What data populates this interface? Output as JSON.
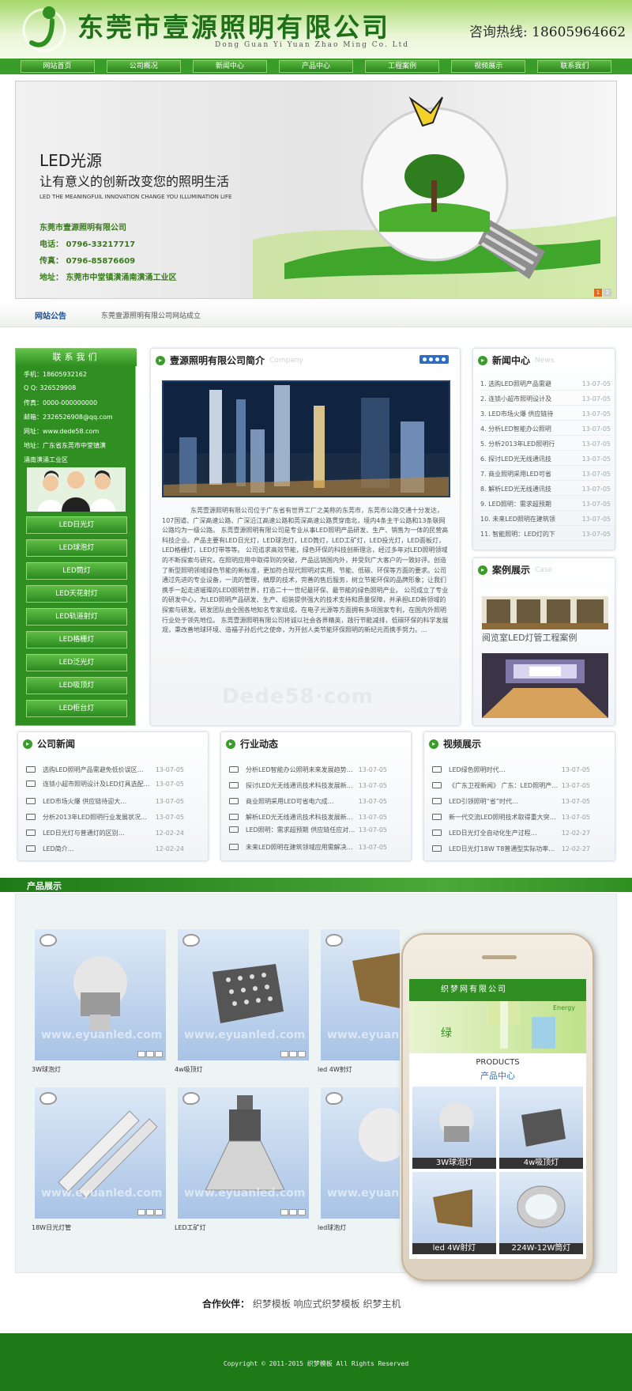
{
  "header": {
    "company": "东莞市壹源照明有限公司",
    "pinyin": "Dong Guan Yi Yuan Zhao Ming Co. Ltd",
    "hotline_label": "咨询热线:",
    "hotline": "18605964662"
  },
  "nav": [
    "网站首页",
    "公司概况",
    "新闻中心",
    "产品中心",
    "工程案例",
    "视频展示",
    "联系我们"
  ],
  "banner": {
    "t1": "LED光源",
    "t2": "让有意义的创新改变您的照明生活",
    "t3": "LED THE MEANINGFUIL INNOVATION CHANGE YOU  ILLUMINATION LIFE",
    "company": "东莞市壹源照明有限公司",
    "tel": "电话：  0796-33217717",
    "fax": "传真：  0796-85876609",
    "addr": "地址：  东莞市中堂镇潢涌南潢涌工业区",
    "pages": [
      "1",
      "2"
    ]
  },
  "notice": {
    "title": "网站公告",
    "text": "东莞壹源照明有限公司网站成立"
  },
  "contact": {
    "title": "联系我们",
    "lines": [
      "手机：18605932162",
      "Q Q: 326529908",
      "传真：0000-000000000",
      "邮箱：2326526908@qq.com",
      "网址：www.dede58.com",
      "地址：广东省东莞市中堂镇潢",
      "涌南潢涌工业区"
    ]
  },
  "products_left": [
    "LED日光灯",
    "LED球泡灯",
    "LED筒灯",
    "LED天花射灯",
    "LED轨道射灯",
    "LED格栅灯",
    "LED泛光灯",
    "LED吸顶灯",
    "LED柜台灯"
  ],
  "intro": {
    "title": "壹源照明有限公司简介",
    "sub": "Company",
    "text": "东莞壹源照明有限公司位于广东省有世界工厂之美称的东莞市，东莞市公路交通十分发达，107国道、广深高速公路、广深沿江高速公路和莞深高速公路贯穿南北，境内4条主干公路和13条联网公路均为一级公路。 东莞壹源照明有限公司是专业从事LED照明产品研发、生产、销售为一体的民营高科技企业。产品主要有LED日光灯，LED球泡灯，LED筒灯，LED工矿灯，LED投光灯，LED面板灯，LED格栅灯，LED灯带等等。 公司追求高效节能，绿色环保的科技创新理念，经过多年对LED照明领域的不断探索与研究，在照明应用中取得到的突破，产品远销国内外，并受到广大客户的一致好评。创造了新型照明领域绿色节能的新标准，更加符合现代照明对实用、节能、低碳、环保等方面的要求。公司通过先进的专业设备，一流的管理，缜厚的技术，完善的售后服务，树立节能环保的品牌形象；让我们携手一起走进璀璨的LED照明世界，打造二十一世纪最环保、最节能的绿色照明产业。 公司成立了专业的研发中心，为LED照明产品研发、生产、组装提供强大的技术支持和质量保障，并承担LED新领域的探索与研发。研发团队由全国各地知名专家组成，在电子光源等方面拥有多项国家专利，在国内外照明行业处于领先地位。 东莞壹源照明有限公司将诚以社会各界精英，践行节能减排，低碳环保的科学发展观，秉改善地球环境、造福子孙后代之使命，为开创人类节能环保照明的新纪元而携手努力。..."
  },
  "watermark": "Dede58·com",
  "news": {
    "title": "新闻中心",
    "sub": "News",
    "items": [
      {
        "t": "1. 选购LED照明产品需避",
        "d": "13-07-05"
      },
      {
        "t": "2. 连锁小超市照明设计及",
        "d": "13-07-05"
      },
      {
        "t": "3. LED市场火爆 供应链待",
        "d": "13-07-05"
      },
      {
        "t": "4. 分析LED智能办公照明",
        "d": "13-07-05"
      },
      {
        "t": "5. 分析2013年LED照明行",
        "d": "13-07-05"
      },
      {
        "t": "6. 探讨LED光无线通讯技",
        "d": "13-07-05"
      },
      {
        "t": "7. 商业照明采用LED可省",
        "d": "13-07-05"
      },
      {
        "t": "8. 解析LED光无线通讯技",
        "d": "13-07-05"
      },
      {
        "t": "9. LED照明：需求超预期",
        "d": "13-07-05"
      },
      {
        "t": "10. 未来LED照明在建筑领",
        "d": "13-07-05"
      },
      {
        "t": "11. 智能照明：LED灯的下",
        "d": "13-07-05"
      }
    ]
  },
  "cases": {
    "title": "案例展示",
    "sub": "Case",
    "caption": "阅览室LED灯管工程案例"
  },
  "company_news": {
    "title": "公司新闻",
    "items": [
      {
        "t": "选购LED照明产品需避免低价误区…",
        "d": "13-07-05"
      },
      {
        "t": "连锁小超市照明设计及LED灯具选配…",
        "d": "13-07-05"
      },
      {
        "t": "LED市场火爆 供应链待迎大…",
        "d": "13-07-05"
      },
      {
        "t": "分析2013年LED照明行业发展状况…",
        "d": "13-07-05"
      },
      {
        "t": "LED日光灯与普通灯的区别…",
        "d": "12-02-24"
      },
      {
        "t": "LED简介…",
        "d": "12-02-24"
      }
    ]
  },
  "industry": {
    "title": "行业动态",
    "items": [
      {
        "t": "分析LED智能办公照明未来发展趋势…",
        "d": "13-07-05"
      },
      {
        "t": "探讨LED光无线通讯技术科技发展新…",
        "d": "13-07-05"
      },
      {
        "t": "商业照明采用LED可省电六成…",
        "d": "13-07-05"
      },
      {
        "t": "解析LED光无线通讯技术科技发展新…",
        "d": "13-07-05"
      },
      {
        "t": "LED照明：需求超预期 供应链任应对…",
        "d": "13-07-05"
      },
      {
        "t": "未来LED照明在建筑领域应用需解决…",
        "d": "13-07-05"
      }
    ]
  },
  "video": {
    "title": "视频展示",
    "items": [
      {
        "t": "LED绿色照明时代…",
        "d": "13-07-05"
      },
      {
        "t": "《广东卫视新闻》 广东：LED照明产…",
        "d": "13-07-05"
      },
      {
        "t": "LED引领照明“省”时代…",
        "d": "13-07-05"
      },
      {
        "t": "新一代交流LED照明技术取得重大突…",
        "d": "13-07-05"
      },
      {
        "t": "LED日光灯全自动化生产过程…",
        "d": "12-02-27"
      },
      {
        "t": "LED日光灯18W T8普通型实际功率…",
        "d": "12-02-27"
      }
    ]
  },
  "products": {
    "title": "产品展示",
    "watermark": "www.eyuanled.com",
    "items": [
      "3W球泡灯",
      "4w吸顶灯",
      "led 4W射灯",
      "18W日光灯管",
      "LED工矿灯",
      "led球泡灯"
    ]
  },
  "phone": {
    "site": "织梦网有限公司",
    "banner": "Energy",
    "p1": "PRODUCTS",
    "p2": "产品中心",
    "items": [
      "3W球泡灯",
      "4w吸顶灯",
      "led 4W射灯",
      "224W-12W筒灯"
    ]
  },
  "partner": {
    "label": "合作伙伴：",
    "links": "织梦模板  响应式织梦模板  织梦主机"
  },
  "footer": {
    "copy": "Copyright © 2011-2015 织梦模板 All Rights Reserved"
  },
  "colors": {
    "brand": "#2f8f21",
    "accent": "#e06a1f",
    "link": "#1e4b90"
  }
}
